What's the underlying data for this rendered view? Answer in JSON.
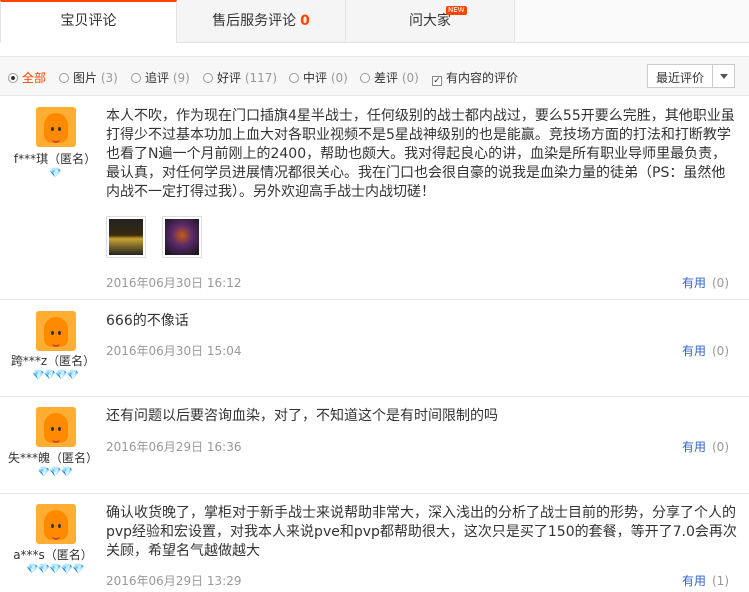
{
  "tabs": [
    {
      "label": "宝贝评论",
      "active": true
    },
    {
      "label": "售后服务评论",
      "count": "0"
    },
    {
      "label": "问大家",
      "badge": "NEW"
    }
  ],
  "filter": {
    "all": "全部",
    "pics": "图片",
    "pics_n": "(3)",
    "append": "追评",
    "append_n": "(9)",
    "good": "好评",
    "good_n": "(117)",
    "mid": "中评",
    "mid_n": "(0)",
    "bad": "差评",
    "bad_n": "(0)",
    "withcontent": "有内容的评价",
    "sort": "最近评价"
  },
  "colors": {
    "accent": "#ff4400",
    "link": "#3366cc",
    "heart": "#e4393c"
  },
  "reviews": [
    {
      "user": "f***琪（匿名）",
      "hearts": "💎",
      "content": "本人不吹，作为现在门口插旗4星半战士，任何级别的战士都内战过，要么55开要么完胜，其他职业虽打得少不过基本功加上血大对各职业视频不是5星战神级别的也是能赢。竞技场方面的打法和打断教学也看了N遍一个月前刚上的2400，帮助也颇大。我对得起良心的讲，血染是所有职业导师里最负责，最认真，对任何学员进展情况都很关心。我在门口也会很自豪的说我是血染力量的徒弟（PS：虽然他内战不一定打得过我）。另外欢迎高手战士内战切磋！",
      "date": "2016年06月30日 16:12",
      "useful": "有用",
      "useful_n": "(0)"
    },
    {
      "user": "跨***z（匿名）",
      "hearts": "💎💎💎💎",
      "content": "666的不像话",
      "date": "2016年06月30日 15:04",
      "useful": "有用",
      "useful_n": "(0)"
    },
    {
      "user": "失***魄（匿名）",
      "hearts": "💎💎💎",
      "content": "还有问题以后要咨询血染，对了，不知道这个是有时间限制的吗",
      "date": "2016年06月29日 16:36",
      "useful": "有用",
      "useful_n": "(0)"
    },
    {
      "user": "a***s（匿名）",
      "hearts": "💎💎💎💎💎",
      "content": "确认收货晚了，掌柜对于新手战士来说帮助非常大，深入浅出的分析了战士目前的形势，分享了个人的pvp经验和宏设置，对我本人来说pve和pvp都帮助很大，这次只是买了150的套餐，等开了7.0会再次关顾，希望名气越做越大",
      "date": "2016年06月29日 13:29",
      "useful": "有用",
      "useful_n": "(1)"
    }
  ]
}
